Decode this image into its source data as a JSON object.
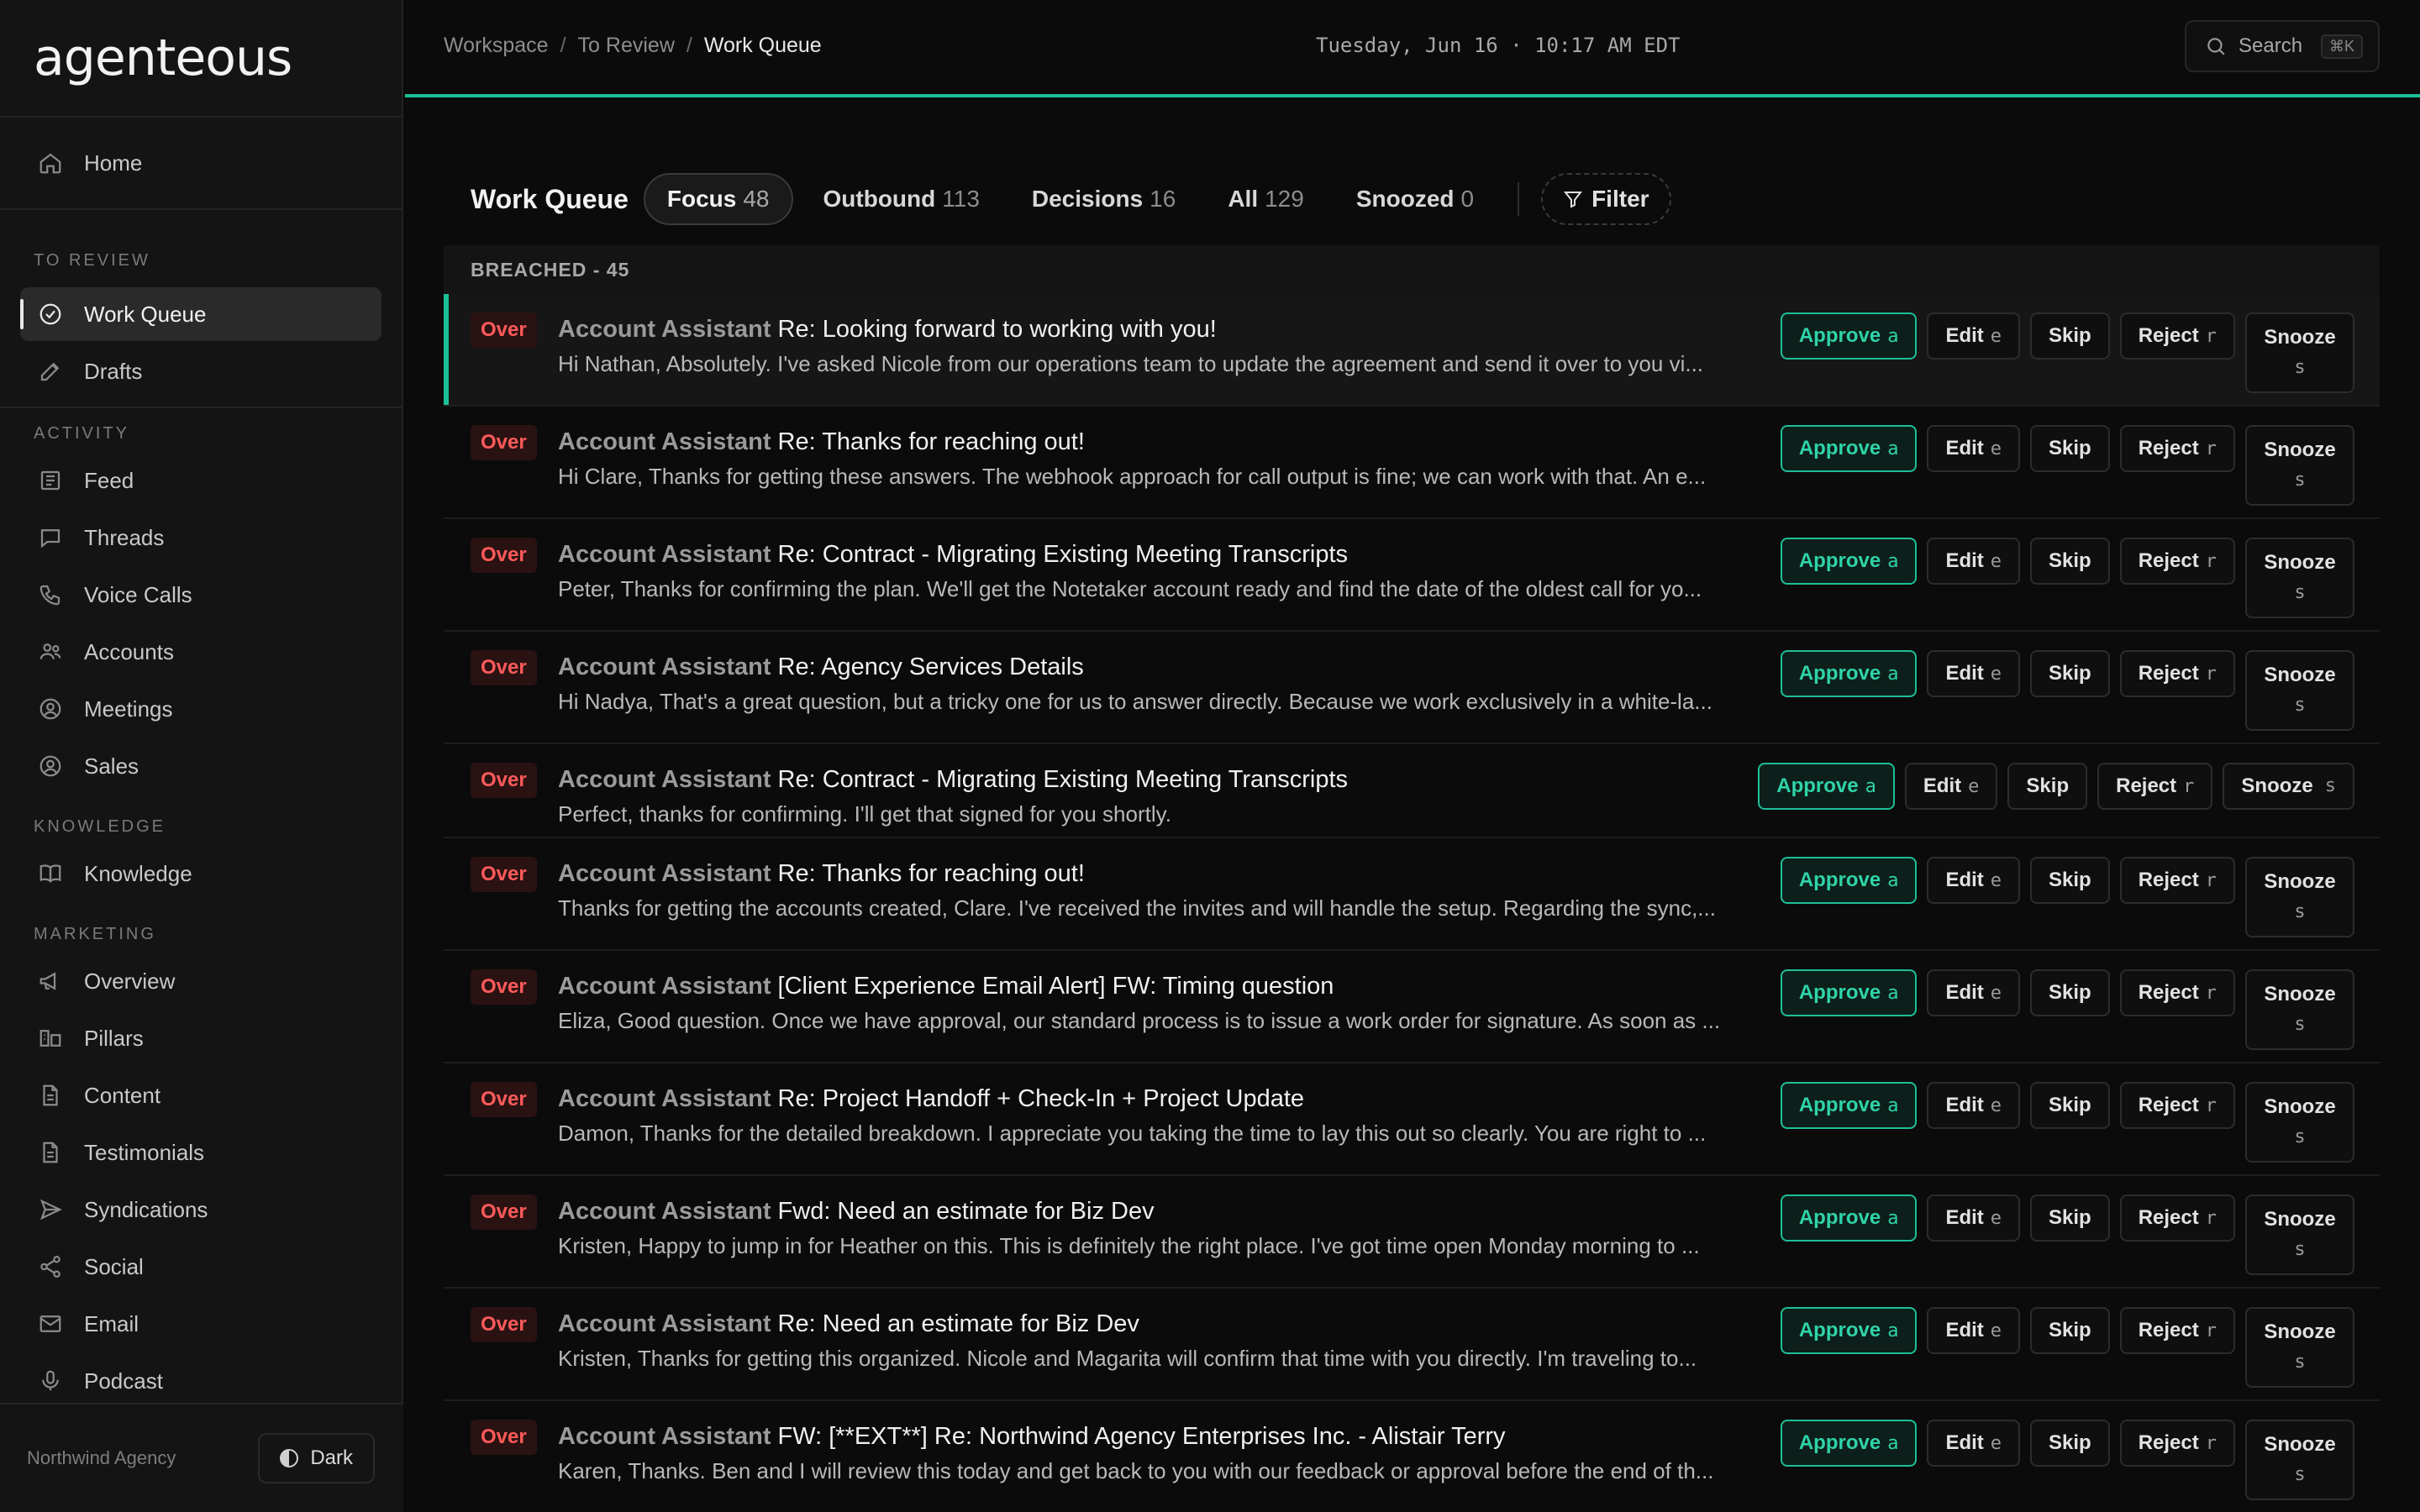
{
  "app": {
    "logo": "agenteous",
    "org": "Northwind Agency",
    "theme_label": "Dark"
  },
  "sidebar": {
    "home": "Home",
    "sections": [
      {
        "label": "TO REVIEW",
        "items": [
          {
            "label": "Work Queue",
            "icon": "check-circle-icon",
            "active": true
          },
          {
            "label": "Drafts",
            "icon": "pencil-icon"
          }
        ]
      },
      {
        "label": "ACTIVITY",
        "items": [
          {
            "label": "Feed",
            "icon": "newspaper-icon"
          },
          {
            "label": "Threads",
            "icon": "chat-icon"
          },
          {
            "label": "Voice Calls",
            "icon": "phone-icon"
          },
          {
            "label": "Accounts",
            "icon": "users-icon"
          },
          {
            "label": "Meetings",
            "icon": "user-circle-icon"
          },
          {
            "label": "Sales",
            "icon": "user-circle-icon"
          }
        ]
      },
      {
        "label": "KNOWLEDGE",
        "items": [
          {
            "label": "Knowledge",
            "icon": "book-icon"
          }
        ]
      },
      {
        "label": "MARKETING",
        "items": [
          {
            "label": "Overview",
            "icon": "megaphone-icon"
          },
          {
            "label": "Pillars",
            "icon": "pillars-icon"
          },
          {
            "label": "Content",
            "icon": "document-icon"
          },
          {
            "label": "Testimonials",
            "icon": "document-icon"
          },
          {
            "label": "Syndications",
            "icon": "send-icon"
          },
          {
            "label": "Social",
            "icon": "share-icon"
          },
          {
            "label": "Email",
            "icon": "mail-icon"
          },
          {
            "label": "Podcast",
            "icon": "mic-icon"
          }
        ]
      }
    ]
  },
  "topbar": {
    "breadcrumb": [
      "Workspace",
      "To Review",
      "Work Queue"
    ],
    "datetime": "Tuesday, Jun 16 · 10:17 AM EDT",
    "search_label": "Search",
    "search_shortcut": "⌘K"
  },
  "queue": {
    "title": "Work Queue",
    "tabs": [
      {
        "label": "Focus",
        "count": "48",
        "active": true
      },
      {
        "label": "Outbound",
        "count": "113"
      },
      {
        "label": "Decisions",
        "count": "16"
      },
      {
        "label": "All",
        "count": "129"
      },
      {
        "label": "Snoozed",
        "count": "0"
      }
    ],
    "filter_label": "Filter",
    "group_header": "BREACHED - 45",
    "actions": {
      "approve": "Approve",
      "approve_key": "a",
      "edit": "Edit",
      "edit_key": "e",
      "skip": "Skip",
      "reject": "Reject",
      "reject_key": "r",
      "snooze": "Snooze",
      "snooze_key": "s"
    },
    "badge": "Over",
    "rows": [
      {
        "sender": "Account Assistant",
        "subject": "Re: Looking forward to working with you!",
        "preview": "Hi Nathan, Absolutely. I've asked Nicole from our operations team to update the agreement and send it over to you vi..."
      },
      {
        "sender": "Account Assistant",
        "subject": "Re: Thanks for reaching out!",
        "preview": "Hi Clare, Thanks for getting these answers. The webhook approach for call output is fine; we can work with that. An e..."
      },
      {
        "sender": "Account Assistant",
        "subject": "Re: Contract - Migrating Existing Meeting Transcripts",
        "preview": "Peter, Thanks for confirming the plan. We'll get the Notetaker account ready and find the date of the oldest call for yo..."
      },
      {
        "sender": "Account Assistant",
        "subject": "Re: Agency Services Details",
        "preview": "Hi Nadya, That's a great question, but a tricky one for us to answer directly. Because we work exclusively in a white-la..."
      },
      {
        "sender": "Account Assistant",
        "subject": "Re: Contract - Migrating Existing Meeting Transcripts",
        "preview": "Perfect, thanks for confirming. I'll get that signed for you shortly."
      },
      {
        "sender": "Account Assistant",
        "subject": "Re: Thanks for reaching out!",
        "preview": "Thanks for getting the accounts created, Clare. I've received the invites and will handle the setup. Regarding the sync,..."
      },
      {
        "sender": "Account Assistant",
        "subject": "[Client Experience Email Alert] FW: Timing question",
        "preview": "Eliza, Good question. Once we have approval, our standard process is to issue a work order for signature. As soon as ..."
      },
      {
        "sender": "Account Assistant",
        "subject": "Re: Project Handoff + Check-In + Project Update",
        "preview": "Damon, Thanks for the detailed breakdown. I appreciate you taking the time to lay this out so clearly. You are right to ..."
      },
      {
        "sender": "Account Assistant",
        "subject": "Fwd: Need an estimate for Biz Dev",
        "preview": "Kristen, Happy to jump in for Heather on this. This is definitely the right place. I've got time open Monday morning to ..."
      },
      {
        "sender": "Account Assistant",
        "subject": "Re: Need an estimate for Biz Dev",
        "preview": "Kristen, Thanks for getting this organized. Nicole and Magarita will confirm that time with you directly. I'm traveling to..."
      },
      {
        "sender": "Account Assistant",
        "subject": "FW: [**EXT**] Re: Northwind Agency Enterprises Inc. - Alistair Terry",
        "preview": "Karen, Thanks. Ben and I will review this today and get back to you with our feedback or approval before the end of th..."
      }
    ]
  },
  "colors": {
    "accent": "#1dbf97",
    "overdue": "#ff5a5a",
    "background": "#0b0b0b",
    "sidebar": "#141414"
  }
}
